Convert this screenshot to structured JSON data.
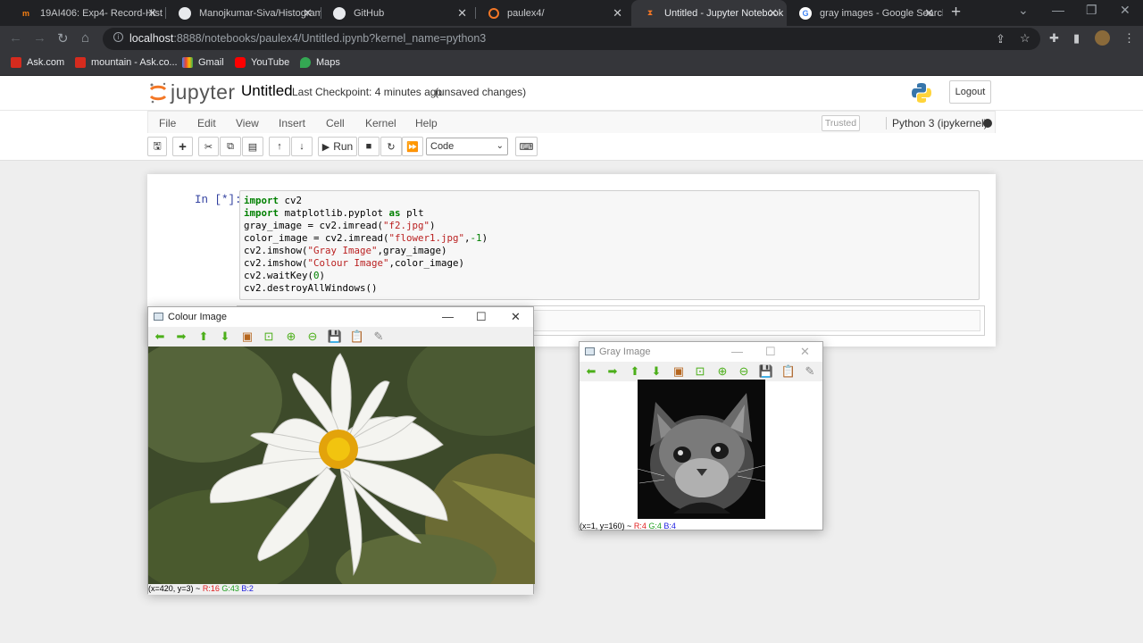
{
  "browser": {
    "tabs": [
      {
        "label": "19AI406: Exp4- Record-Hist",
        "favicon": "moodle-icon"
      },
      {
        "label": "Manojkumar-Siva/Histogram",
        "favicon": "github-icon"
      },
      {
        "label": "GitHub",
        "favicon": "github-icon"
      },
      {
        "label": "paulex4/",
        "favicon": "jupyter-icon"
      },
      {
        "label": "Untitled - Jupyter Notebook",
        "favicon": "hourglass-icon"
      },
      {
        "label": "gray images - Google Search",
        "favicon": "google-icon"
      }
    ],
    "address": {
      "host": "localhost",
      "path": ":8888/notebooks/paulex4/Untitled.ipynb?kernel_name=python3"
    },
    "bookmarks": [
      "Ask.com",
      "mountain - Ask.co...",
      "Gmail",
      "YouTube",
      "Maps"
    ]
  },
  "jupyter": {
    "logo_text": "jupyter",
    "notebook_name": "Untitled",
    "checkpoint": "Last Checkpoint: 4 minutes ago",
    "unsaved": "(unsaved changes)",
    "logout": "Logout",
    "menu": [
      "File",
      "Edit",
      "View",
      "Insert",
      "Cell",
      "Kernel",
      "Help"
    ],
    "trusted": "Trusted",
    "kernel_name": "Python 3 (ipykernel)",
    "toolbar": {
      "run_label": "Run",
      "cell_type": "Code"
    }
  },
  "cell": {
    "prompt": "In [*]:",
    "code": [
      "import cv2",
      "import matplotlib.pyplot as plt",
      "gray_image = cv2.imread(\"f2.jpg\")",
      "color_image = cv2.imread(\"flower1.jpg\",-1)",
      "cv2.imshow(\"Gray Image\",gray_image)",
      "cv2.imshow(\"Colour Image\",color_image)",
      "cv2.waitKey(0)",
      "cv2.destroyAllWindows()"
    ]
  },
  "colour_window": {
    "title": "Colour Image",
    "status_pos": "(x=420, y=3) ~",
    "status_r": "R:16",
    "status_g": "G:43",
    "status_b": "B:2"
  },
  "gray_window": {
    "title": "Gray Image",
    "status_pos": "(x=1, y=160) ~",
    "status_r": "R:4",
    "status_g": "G:4",
    "status_b": "B:4"
  }
}
